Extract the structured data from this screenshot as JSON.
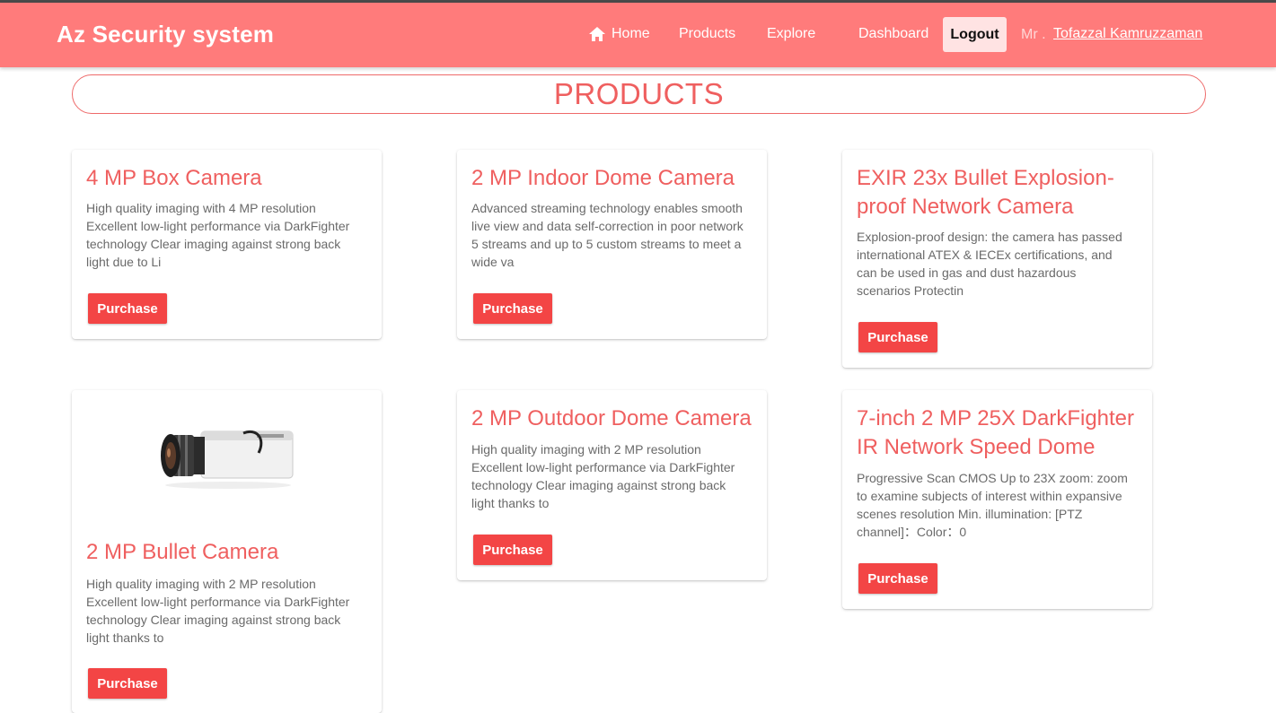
{
  "header": {
    "brand": "Az Security system",
    "nav": {
      "home": "Home",
      "products": "Products",
      "explore": "Explore",
      "dashboard": "Dashboard",
      "logout": "Logout"
    },
    "user_prefix": "Mr .",
    "user_name": "Tofazzal Kamruzzaman"
  },
  "page_title": "PRODUCTS",
  "products": [
    {
      "title": "4 MP Box Camera",
      "description": "High quality imaging with 4 MP resolution Excellent low-light performance via DarkFighter technology Clear imaging against strong back light due to Li",
      "button": "Purchase"
    },
    {
      "title": "2 MP Indoor Dome Camera",
      "description": "Advanced streaming technology enables smooth live view and data self-correction in poor network 5 streams and up to 5 custom streams to meet a wide va",
      "button": "Purchase"
    },
    {
      "title": "EXIR 23x Bullet Explosion-proof Network Camera",
      "description": "Explosion-proof design: the camera has passed international ATEX & IECEx certifications, and can be used in gas and dust hazardous scenarios Protectin",
      "button": "Purchase"
    },
    {
      "title": "2 MP Bullet Camera",
      "description": "High quality imaging with 2 MP resolution Excellent low-light performance via DarkFighter technology Clear imaging against strong back light thanks to",
      "button": "Purchase",
      "image_icon": "box-camera-image"
    },
    {
      "title": "2 MP Outdoor Dome Camera",
      "description": "High quality imaging with 2 MP resolution Excellent low-light performance via DarkFighter technology Clear imaging against strong back light thanks to",
      "button": "Purchase"
    },
    {
      "title": "7-inch 2 MP 25X DarkFighter IR Network Speed Dome",
      "description": "Progressive Scan CMOS Up to 23X zoom: zoom to examine subjects of interest within expansive scenes resolution Min. illumination: [PTZ channel]：Color：0",
      "button": "Purchase"
    }
  ],
  "colors": {
    "navbar": "#ff7b7b",
    "accent": "#ef5f5f",
    "button": "#f34545"
  }
}
